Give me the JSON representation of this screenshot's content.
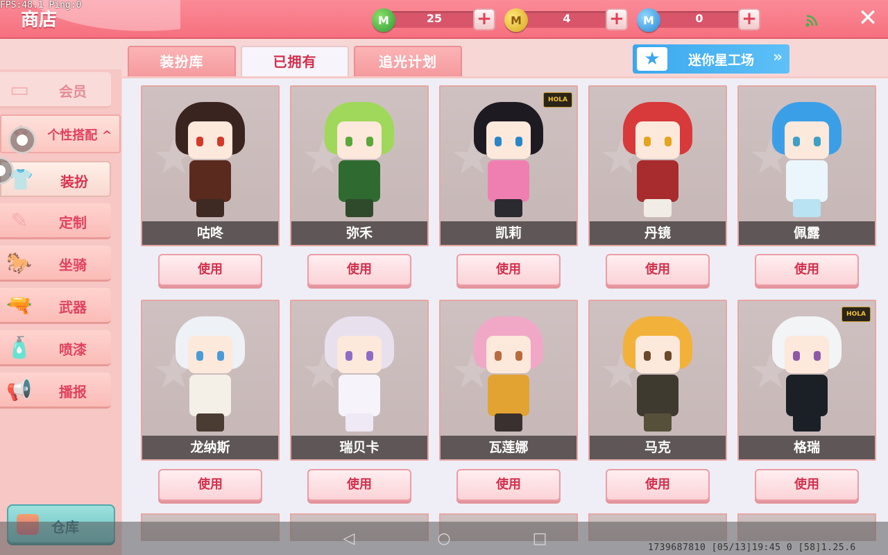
{
  "debug": {
    "fps_text": "FPS:48.1  Ping:0"
  },
  "header": {
    "title": "商店",
    "currencies": [
      {
        "icon": "green-mini-coin-icon",
        "symbol": "M",
        "amount": "25"
      },
      {
        "icon": "gold-mini-coin-icon",
        "symbol": "M",
        "amount": "4"
      },
      {
        "icon": "blue-mini-coin-icon",
        "symbol": "M",
        "amount": "0"
      }
    ],
    "plus_symbol": "+",
    "close_symbol": "✕"
  },
  "sidebar": {
    "member": "会员",
    "group": "个性搭配",
    "group_arrow": "^",
    "items": [
      {
        "label": "装扮",
        "icon": "shirt-icon",
        "glyph": "👕"
      },
      {
        "label": "定制",
        "icon": "pencil-icon",
        "glyph": "✎"
      },
      {
        "label": "坐骑",
        "icon": "mount-icon",
        "glyph": "🐎"
      },
      {
        "label": "武器",
        "icon": "gun-icon",
        "glyph": "🔫"
      },
      {
        "label": "喷漆",
        "icon": "spray-icon",
        "glyph": "🧴"
      },
      {
        "label": "播报",
        "icon": "broadcast-icon",
        "glyph": "📢"
      }
    ],
    "warehouse": "仓库"
  },
  "tabs": [
    {
      "label": "装扮库"
    },
    {
      "label": "已拥有"
    },
    {
      "label": "追光计划"
    }
  ],
  "workshop": {
    "label": "迷你星工场",
    "star": "★",
    "chevron": "»"
  },
  "brand_badge": "HOLA",
  "use_label": "使用",
  "characters": [
    {
      "name": "咕咚",
      "hair": "#3a2420",
      "body": "#5a2a1e",
      "eye": "#d23a2a",
      "legs": "#3e2a22",
      "brand": false
    },
    {
      "name": "弥禾",
      "hair": "#9fd85a",
      "body": "#2f6b30",
      "eye": "#5aa83a",
      "legs": "#2f4a2a",
      "brand": false
    },
    {
      "name": "凯莉",
      "hair": "#1e1a22",
      "body": "#f07fb1",
      "eye": "#2a86c9",
      "legs": "#2a2a30",
      "brand": true
    },
    {
      "name": "丹镜",
      "hair": "#d8393a",
      "body": "#a82b2e",
      "eye": "#e3a41e",
      "legs": "#f1ece6",
      "brand": false
    },
    {
      "name": "佩露",
      "hair": "#3b9fe8",
      "body": "#eaf6fb",
      "eye": "#3fa0c6",
      "legs": "#b9e2f2",
      "brand": false
    },
    {
      "name": "龙纳斯",
      "hair": "#eef1f5",
      "body": "#f4efe7",
      "eye": "#4a9bd8",
      "legs": "#4a3c33",
      "brand": false
    },
    {
      "name": "瑞贝卡",
      "hair": "#e9e0ee",
      "body": "#f6f4fa",
      "eye": "#8f6cc4",
      "legs": "#efe9f5",
      "brand": false
    },
    {
      "name": "瓦莲娜",
      "hair": "#f0a8c6",
      "body": "#e2a332",
      "eye": "#b86b3e",
      "legs": "#3b3030",
      "brand": false
    },
    {
      "name": "马克",
      "hair": "#f2b13a",
      "body": "#3f3a30",
      "eye": "#6a4a2a",
      "legs": "#56503a",
      "brand": false
    },
    {
      "name": "格瑞",
      "hair": "#f2f4f6",
      "body": "#1b2027",
      "eye": "#8d5aa6",
      "legs": "#1b2027",
      "brand": true
    }
  ],
  "navbar": {
    "back_glyph": "◁",
    "home_glyph": "○",
    "recent_glyph": "□",
    "info": "1739687810   [05/13]19:45 0   [58]1.25.6"
  }
}
